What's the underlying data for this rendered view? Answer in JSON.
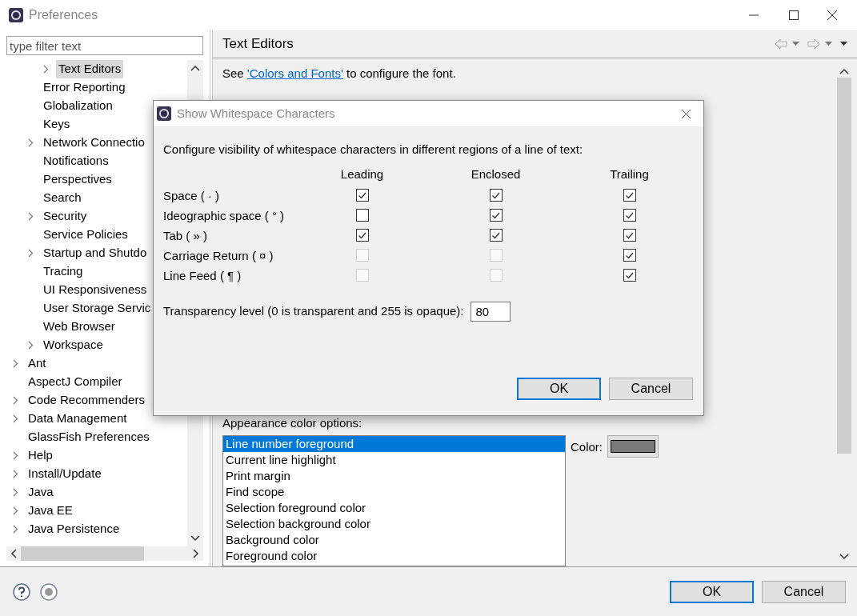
{
  "window": {
    "title": "Preferences"
  },
  "filter": {
    "placeholder": "type filter text"
  },
  "tree": [
    {
      "children": [
        {
          "children": [
            {
              "label": "Text Editors",
              "expandable": true,
              "selected": true
            }
          ]
        },
        {
          "label": "Error Reporting",
          "expandable": false,
          "selected": false
        },
        {
          "label": "Globalization",
          "expandable": false,
          "selected": false
        },
        {
          "label": "Keys",
          "expandable": false,
          "selected": false
        },
        {
          "label": "Network Connectio",
          "expandable": true,
          "selected": false
        },
        {
          "label": "Notifications",
          "expandable": false,
          "selected": false
        },
        {
          "label": "Perspectives",
          "expandable": false,
          "selected": false
        },
        {
          "label": "Search",
          "expandable": false,
          "selected": false
        },
        {
          "label": "Security",
          "expandable": true,
          "selected": false
        },
        {
          "label": "Service Policies",
          "expandable": false,
          "selected": false
        },
        {
          "label": "Startup and Shutdo",
          "expandable": true,
          "selected": false
        },
        {
          "label": "Tracing",
          "expandable": false,
          "selected": false
        },
        {
          "label": "UI Responsiveness",
          "expandable": false,
          "selected": false
        },
        {
          "label": "User Storage Servic",
          "expandable": false,
          "selected": false
        },
        {
          "label": "Web Browser",
          "expandable": false,
          "selected": false
        },
        {
          "label": "Workspace",
          "expandable": true,
          "selected": false
        }
      ]
    },
    {
      "label": "Ant",
      "expandable": true,
      "selected": false
    },
    {
      "label": "AspectJ Compiler",
      "expandable": false,
      "selected": false
    },
    {
      "label": "Code Recommenders",
      "expandable": true,
      "selected": false
    },
    {
      "label": "Data Management",
      "expandable": true,
      "selected": false
    },
    {
      "label": "GlassFish Preferences",
      "expandable": false,
      "selected": false
    },
    {
      "label": "Help",
      "expandable": true,
      "selected": false
    },
    {
      "label": "Install/Update",
      "expandable": true,
      "selected": false
    },
    {
      "label": "Java",
      "expandable": true,
      "selected": false
    },
    {
      "label": "Java EE",
      "expandable": true,
      "selected": false
    },
    {
      "label": "Java Persistence",
      "expandable": true,
      "selected": false
    }
  ],
  "page": {
    "title": "Text Editors",
    "intro_before": "See",
    "link": "'Colors and Fonts'",
    "intro_after": "to configure the font."
  },
  "appearance": {
    "label": "Appearance color options:",
    "items": [
      {
        "label": "Line number foreground",
        "selected": true
      },
      {
        "label": "Current line highlight",
        "selected": false
      },
      {
        "label": "Print margin",
        "selected": false
      },
      {
        "label": "Find scope",
        "selected": false
      },
      {
        "label": "Selection foreground color",
        "selected": false
      },
      {
        "label": "Selection background color",
        "selected": false
      },
      {
        "label": "Background color",
        "selected": false
      },
      {
        "label": "Foreground color",
        "selected": false
      }
    ],
    "color_label": "Color:"
  },
  "buttons": [
    {
      "label": "OK",
      "default": true
    },
    {
      "label": "Cancel",
      "default": false
    }
  ],
  "dialog": {
    "title": "Show Whitespace Characters",
    "description": "Configure visibility of whitespace characters in different regions of a line of text:",
    "columns": [
      "Leading",
      "Enclosed",
      "Trailing"
    ],
    "rows": [
      {
        "label": "Space ( · )",
        "cells": [
          {
            "checked": true,
            "disabled": false
          },
          {
            "checked": true,
            "disabled": false
          },
          {
            "checked": true,
            "disabled": false
          }
        ]
      },
      {
        "label": "Ideographic space ( ° )",
        "cells": [
          {
            "checked": false,
            "disabled": false
          },
          {
            "checked": true,
            "disabled": false
          },
          {
            "checked": true,
            "disabled": false
          }
        ]
      },
      {
        "label": "Tab ( » )",
        "cells": [
          {
            "checked": true,
            "disabled": false
          },
          {
            "checked": true,
            "disabled": false
          },
          {
            "checked": true,
            "disabled": false
          }
        ]
      },
      {
        "label": "Carriage Return ( ¤ )",
        "cells": [
          {
            "checked": false,
            "disabled": true
          },
          {
            "checked": false,
            "disabled": true
          },
          {
            "checked": true,
            "disabled": false
          }
        ]
      },
      {
        "label": "Line Feed ( ¶ )",
        "cells": [
          {
            "checked": false,
            "disabled": true
          },
          {
            "checked": false,
            "disabled": true
          },
          {
            "checked": true,
            "disabled": false
          }
        ]
      }
    ],
    "transparency": {
      "label": "Transparency level (0 is transparent and 255 is opaque):",
      "value": "80"
    },
    "buttons": [
      {
        "label": "OK",
        "default": true
      },
      {
        "label": "Cancel",
        "default": false
      }
    ]
  }
}
